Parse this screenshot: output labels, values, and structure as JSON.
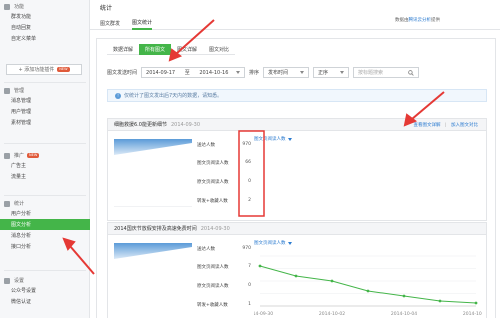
{
  "sidebar": {
    "groups": [
      {
        "title": "功能",
        "items": [
          "群发功能",
          "自动回复",
          "自定义菜单"
        ]
      },
      {
        "title": "管理",
        "items": [
          "消息管理",
          "用户管理",
          "素材管理"
        ]
      },
      {
        "title": "推广",
        "badge": "NEW",
        "items": [
          "广告主",
          "流量主"
        ]
      },
      {
        "title": "统计",
        "items": [
          "用户分析",
          "图文分析",
          "消息分析",
          "接口分析"
        ]
      },
      {
        "title": "设置",
        "items": [
          "公众号设置",
          "微信认证"
        ]
      }
    ],
    "add_plugin_label": "+ 添加功能插件",
    "add_plugin_badge": "NEW",
    "active_item": "图文分析"
  },
  "header": {
    "title": "统计",
    "notice_prefix": "数据由",
    "notice_link": "腾讯云分析",
    "notice_suffix": "提供"
  },
  "top_tabs": [
    "图文群发",
    "图文统计"
  ],
  "sub_tabs": [
    "数据详解",
    "所有图文",
    "图文详解",
    "图文对比"
  ],
  "filter": {
    "label": "图文发送时间",
    "date_start": "2014-09-17",
    "date_sep": "至",
    "date_end": "2014-10-16",
    "sort_label": "排序",
    "sort_value": "发布时间",
    "order_value": "正序",
    "search_placeholder": "按标题搜索"
  },
  "info_text": "仅统计了图文发出后7天内的数据，请知悉。",
  "articles": [
    {
      "title": "细胞救援6.0能更新细节",
      "date": "2014-09-30",
      "links": {
        "detail": "查看图文详解",
        "compare": "加入图文对比"
      },
      "metrics": [
        {
          "label": "送达人数",
          "value": "970"
        },
        {
          "label": "图文页阅读人数",
          "value": "66"
        },
        {
          "label": "原文页阅读人数",
          "value": "0"
        },
        {
          "label": "转发+收藏人数",
          "value": "2"
        }
      ],
      "trend_select": "图文页阅读人数"
    },
    {
      "title": "2014国庆节放假安排及高速免费时间",
      "date": "2014-09-30",
      "links": {
        "detail": "查看图文详解",
        "compare": "加入图文对比"
      },
      "metrics": [
        {
          "label": "送达人数",
          "value": "970"
        },
        {
          "label": "图文页阅读人数",
          "value": "7"
        },
        {
          "label": "原文页阅读人数",
          "value": "0"
        },
        {
          "label": "转发+收藏人数",
          "value": "1"
        }
      ],
      "trend_select": "图文页阅读人数",
      "chart_data": {
        "type": "line",
        "x": [
          "2014-09-30",
          "2014-10-01",
          "2014-10-02",
          "2014-10-03",
          "2014-10-04",
          "2014-10-05",
          "2014-10-06"
        ],
        "x_ticks": [
          "2014-09-30",
          "2014-10-02",
          "2014-10-04",
          "2014-10-06"
        ],
        "values": [
          4,
          3,
          2.5,
          1.5,
          1,
          0.5,
          0.3
        ],
        "ylim": [
          0,
          5
        ],
        "grid": true,
        "color": "#44b549"
      }
    }
  ],
  "colors": {
    "accent": "#44b549",
    "link": "#2b7bd0",
    "annotation": "#e53935"
  }
}
